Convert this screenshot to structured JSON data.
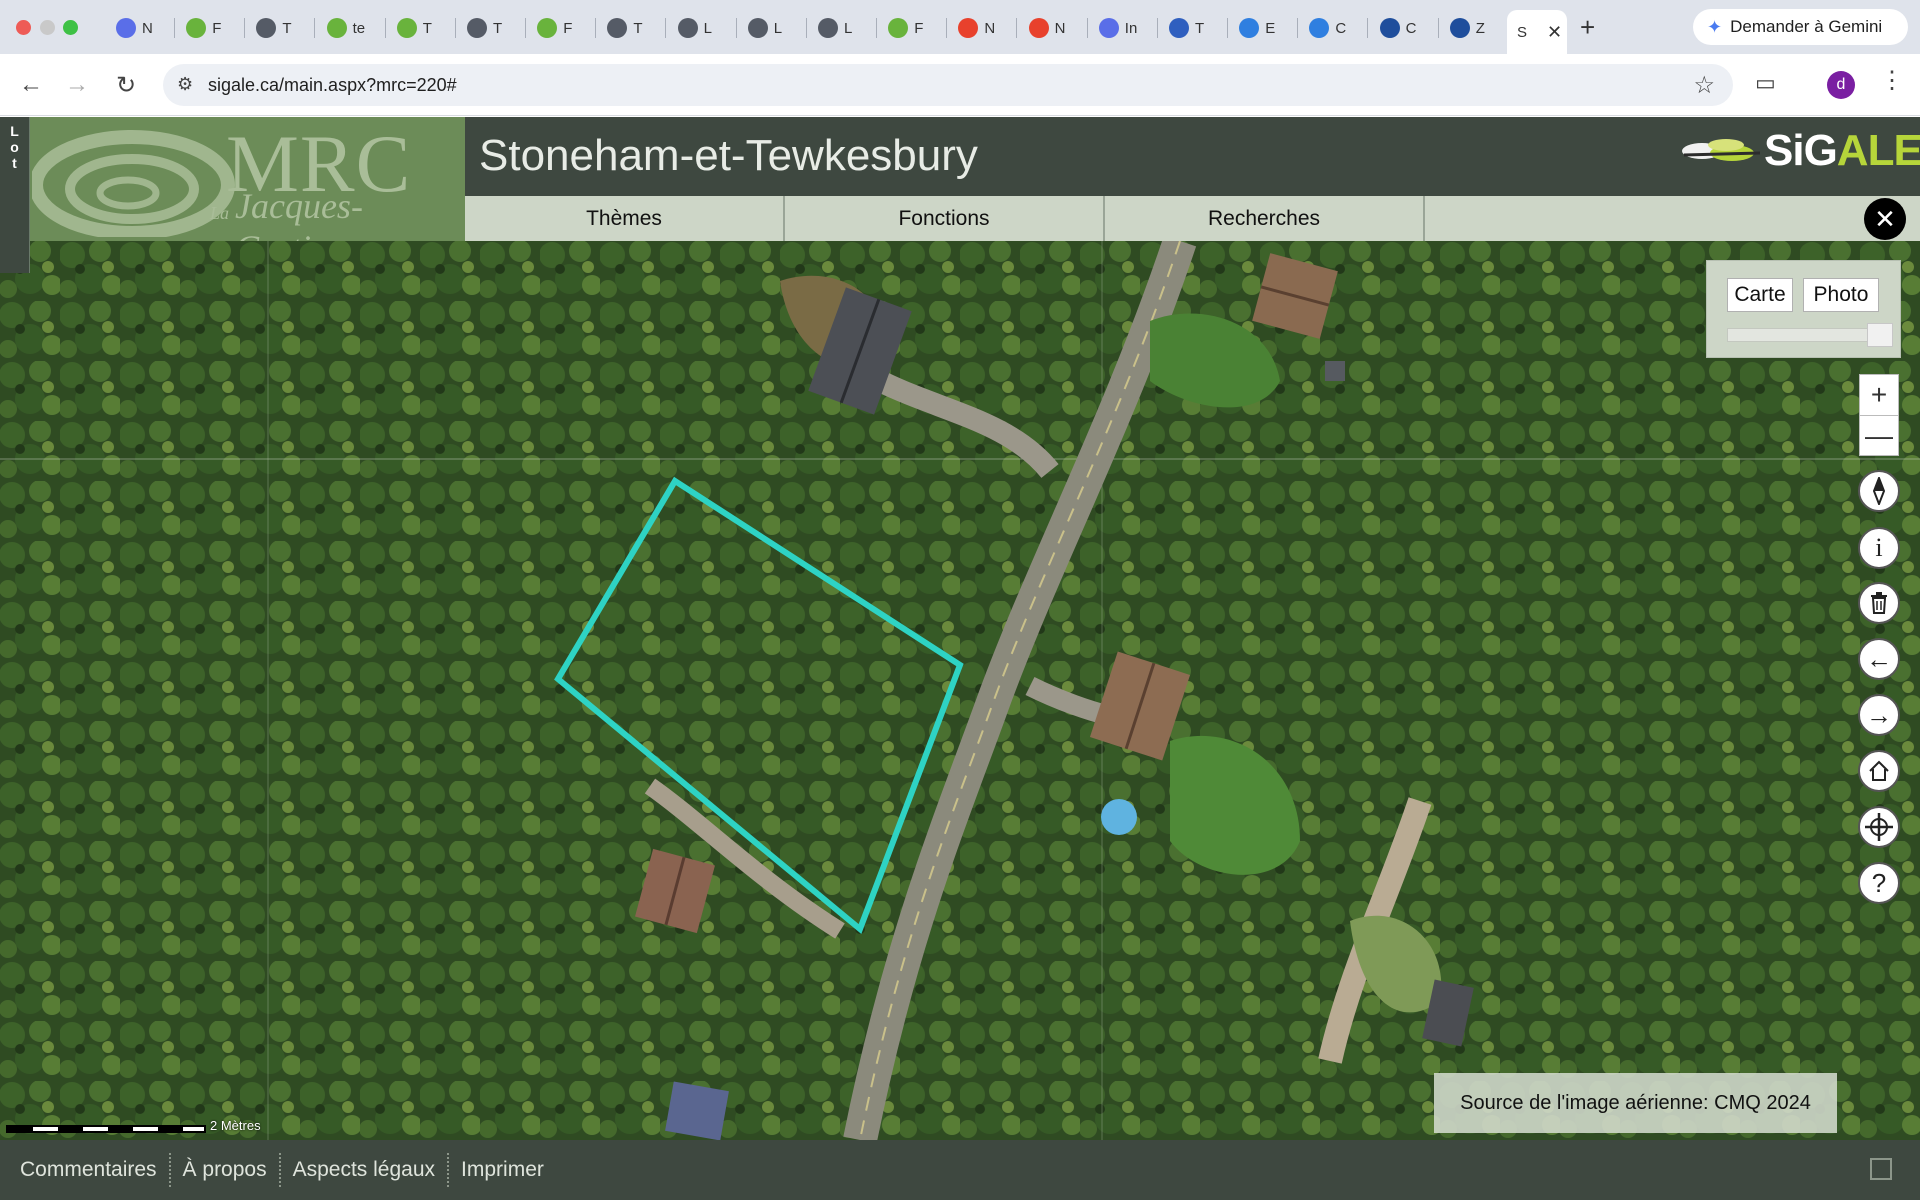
{
  "browser": {
    "tabs": [
      {
        "letter": "N",
        "fav_color": "#5a6ee8"
      },
      {
        "letter": "F",
        "fav_color": "#69b33c"
      },
      {
        "letter": "T",
        "fav_color": "#555b66"
      },
      {
        "letter": "te",
        "fav_color": "#69b33c"
      },
      {
        "letter": "T",
        "fav_color": "#69b33c"
      },
      {
        "letter": "T",
        "fav_color": "#555b66"
      },
      {
        "letter": "F",
        "fav_color": "#69b33c"
      },
      {
        "letter": "T",
        "fav_color": "#555b66"
      },
      {
        "letter": "L",
        "fav_color": "#555b66"
      },
      {
        "letter": "L",
        "fav_color": "#555b66"
      },
      {
        "letter": "L",
        "fav_color": "#555b66"
      },
      {
        "letter": "F",
        "fav_color": "#69b33c"
      },
      {
        "letter": "N",
        "fav_color": "#e8412c"
      },
      {
        "letter": "N",
        "fav_color": "#e8412c"
      },
      {
        "letter": "In",
        "fav_color": "#5a6ee8"
      },
      {
        "letter": "T",
        "fav_color": "#2f5fbf"
      },
      {
        "letter": "E",
        "fav_color": "#2f7fe0"
      },
      {
        "letter": "C",
        "fav_color": "#2f7fe0"
      },
      {
        "letter": "C",
        "fav_color": "#1f4e9c"
      },
      {
        "letter": "Z",
        "fav_color": "#1f4e9c"
      }
    ],
    "active_tab": {
      "letter": "S",
      "close": "✕"
    },
    "new_tab": "+",
    "gemini_label": "Demander à Gemini",
    "url": "sigale.ca/main.aspx?mrc=220#",
    "profile_initial": "d"
  },
  "app": {
    "lot_tab": [
      "L",
      "o",
      "t"
    ],
    "logo": {
      "mrc": "MRC",
      "la": "La",
      "jacques_cartier": "Jacques-Cartier"
    },
    "title": "Stoneham-et-Tewkesbury",
    "brand": {
      "prefix": "SiG",
      "suffix": "ALE"
    },
    "menu": [
      "Thèmes",
      "Fonctions",
      "Recherches"
    ]
  },
  "map": {
    "basemap": {
      "carte": "Carte",
      "photo": "Photo"
    },
    "opacity": 1.0,
    "zoom_in": "+",
    "zoom_out": "—",
    "attribution": "Source de l'image aérienne: CMQ 2024",
    "scale_label": "2 Mètres",
    "parcel_color": "#2ed3c4"
  },
  "footer": {
    "links": [
      "Commentaires",
      "À propos",
      "Aspects légaux",
      "Imprimer"
    ]
  }
}
